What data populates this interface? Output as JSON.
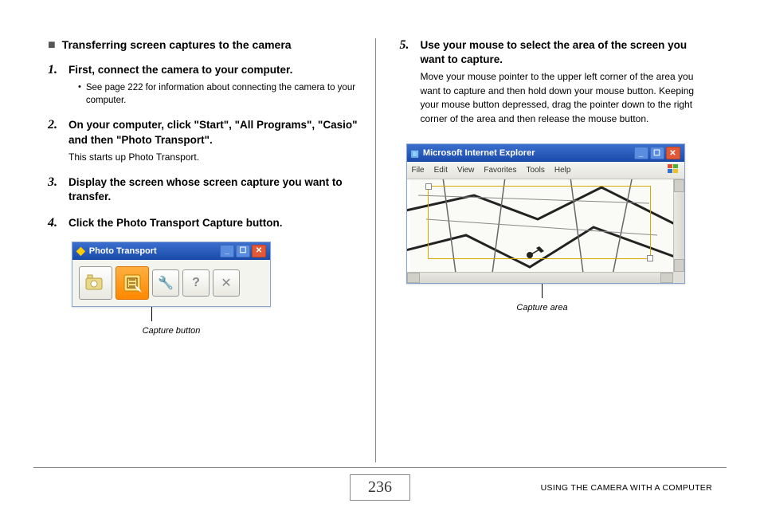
{
  "section_title": "Transferring screen captures to the camera",
  "steps": [
    {
      "num": "1.",
      "head": "First, connect the camera to your computer.",
      "bullet": "See page 222 for information about connecting the camera to your computer."
    },
    {
      "num": "2.",
      "head": "On your computer, click \"Start\", \"All Programs\", \"Casio\" and then \"Photo Transport\".",
      "desc": "This starts up Photo Transport."
    },
    {
      "num": "3.",
      "head": "Display the screen whose screen capture you want to transfer."
    },
    {
      "num": "4.",
      "head": "Click the Photo Transport Capture button."
    }
  ],
  "step5": {
    "num": "5.",
    "head": "Use your mouse to select the area of the screen you want to capture.",
    "desc": "Move your mouse pointer to the upper left corner of the area you want to capture and then hold down your mouse button. Keeping your mouse button depressed, drag the pointer down to the right corner of the area and then release the mouse button."
  },
  "pt_window": {
    "title": "Photo Transport",
    "caption": "Capture button"
  },
  "ie_window": {
    "title": "Microsoft Internet Explorer",
    "menu": [
      "File",
      "Edit",
      "View",
      "Favorites",
      "Tools",
      "Help"
    ],
    "caption": "Capture area"
  },
  "footer": {
    "page_number": "236",
    "section_label": "USING THE CAMERA WITH A COMPUTER"
  }
}
